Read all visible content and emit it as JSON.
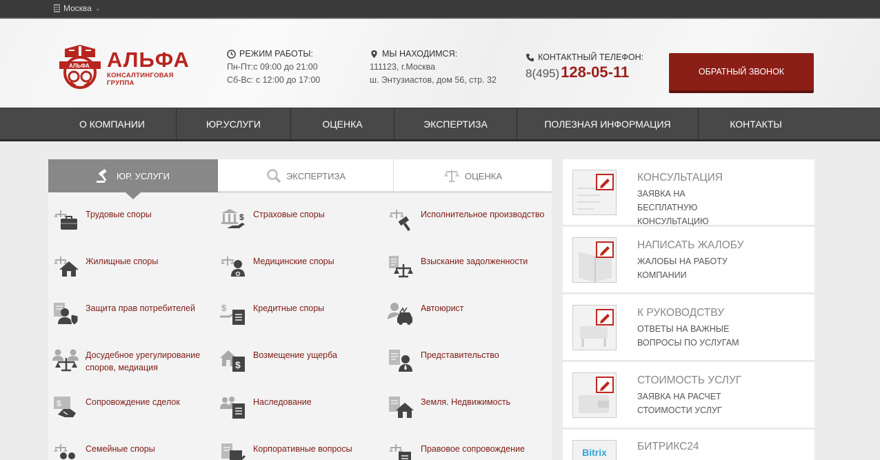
{
  "topbar": {
    "city": "Москва"
  },
  "header": {
    "logo": {
      "brand": "АЛЬФА",
      "subtitle": "КОНСАЛТИНГОВАЯ ГРУППА",
      "emblem_text": "АЛЬФА"
    },
    "hours": {
      "title": "РЕЖИМ РАБОТЫ:",
      "weekdays": "Пн-Пт:с 09:00 до 21:00",
      "weekend": "Сб-Вс: с 12:00 до 17:00"
    },
    "address": {
      "title": "МЫ НАХОДИМСЯ:",
      "line1": "111123, г.Москва",
      "line2": "ш. Энтузиастов, дом 56, стр. 32"
    },
    "phone": {
      "title": "КОНТАКТНЫЙ ТЕЛЕФОН:",
      "prefix": "8(495)",
      "number": "128-05-11"
    },
    "callback_label": "ОБРАТНЫЙ ЗВОНОК"
  },
  "nav": [
    "О КОМПАНИИ",
    "ЮР.УСЛУГИ",
    "ОЦЕНКА",
    "ЭКСПЕРТИЗА",
    "ПОЛЕЗНАЯ ИНФОРМАЦИЯ",
    "КОНТАКТЫ"
  ],
  "tabs": [
    "ЮР. УСЛУГИ",
    "ЭКСПЕРТИЗА",
    "ОЦЕНКА"
  ],
  "services": [
    [
      "Трудовые споры",
      "Страховые споры",
      "Исполнительное производство"
    ],
    [
      "Жилищные споры",
      "Медицинские споры",
      "Взыскание задолженности"
    ],
    [
      "Защита прав потребителей",
      "Кредитные споры",
      "Автоюрист"
    ],
    [
      "Досудебное урегулирование споров, медиация",
      "Возмещение ущерба",
      "Представительство"
    ],
    [
      "Сопровождение сделок",
      "Наследование",
      "Земля. Недвижимость"
    ],
    [
      "Семейные споры",
      "Корпоративные вопросы",
      "Правовое сопровождение"
    ]
  ],
  "sidebar": [
    {
      "title": "КОНСУЛЬТАЦИЯ",
      "desc": "ЗАЯВКА НА БЕСПЛАТНУЮ КОНСУЛЬТАЦИЮ"
    },
    {
      "title": "НАПИСАТЬ ЖАЛОБУ",
      "desc": "ЖАЛОБЫ НА РАБОТУ КОМПАНИИ"
    },
    {
      "title": "К РУКОВОДСТВУ",
      "desc": "ОТВЕТЫ НА ВАЖНЫЕ ВОПРОСЫ ПО УСЛУГАМ"
    },
    {
      "title": "СТОИМОСТЬ УСЛУГ",
      "desc": "ЗАЯВКА НА РАСЧЕТ СТОИМОСТИ УСЛУГ"
    },
    {
      "title": "БИТРИКС24",
      "desc": "",
      "logo_text": "Bitrix"
    }
  ],
  "colors": {
    "brand": "#b7251f",
    "dark_red": "#8b1e16",
    "nav": "#484848",
    "link": "#7d1a14"
  }
}
